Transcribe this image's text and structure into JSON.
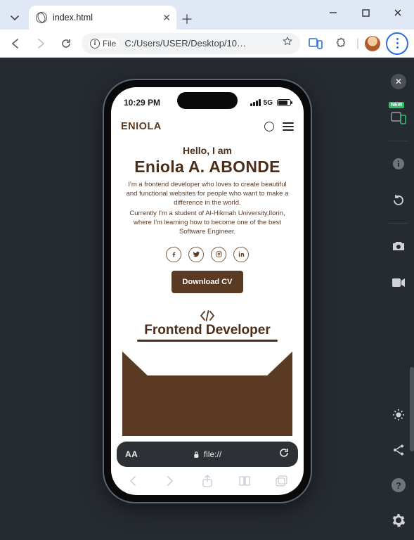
{
  "browser": {
    "tab_title": "index.html",
    "url_prefix": "File",
    "url": "C:/Users/USER/Desktop/10…"
  },
  "phone": {
    "status": {
      "time": "10:29 PM",
      "network": "5G"
    },
    "safari_url": "file://",
    "text_size_label": "AA"
  },
  "site": {
    "logo": "ENIOLA",
    "hello": "Hello, I am",
    "name": "Eniola A. ABONDE",
    "bio1": "I'm a frontend developer who loves to create beautiful and functional websites for people who want to make a difference in the world.",
    "bio2": "Currently I'm a student of Al-Hikmah University,Ilorin, where I'm learning how to become one of the best Software Engineer.",
    "download_cv": "Download CV",
    "role": "Frontend Developer"
  },
  "devtools": {
    "new_label": "NEW"
  }
}
